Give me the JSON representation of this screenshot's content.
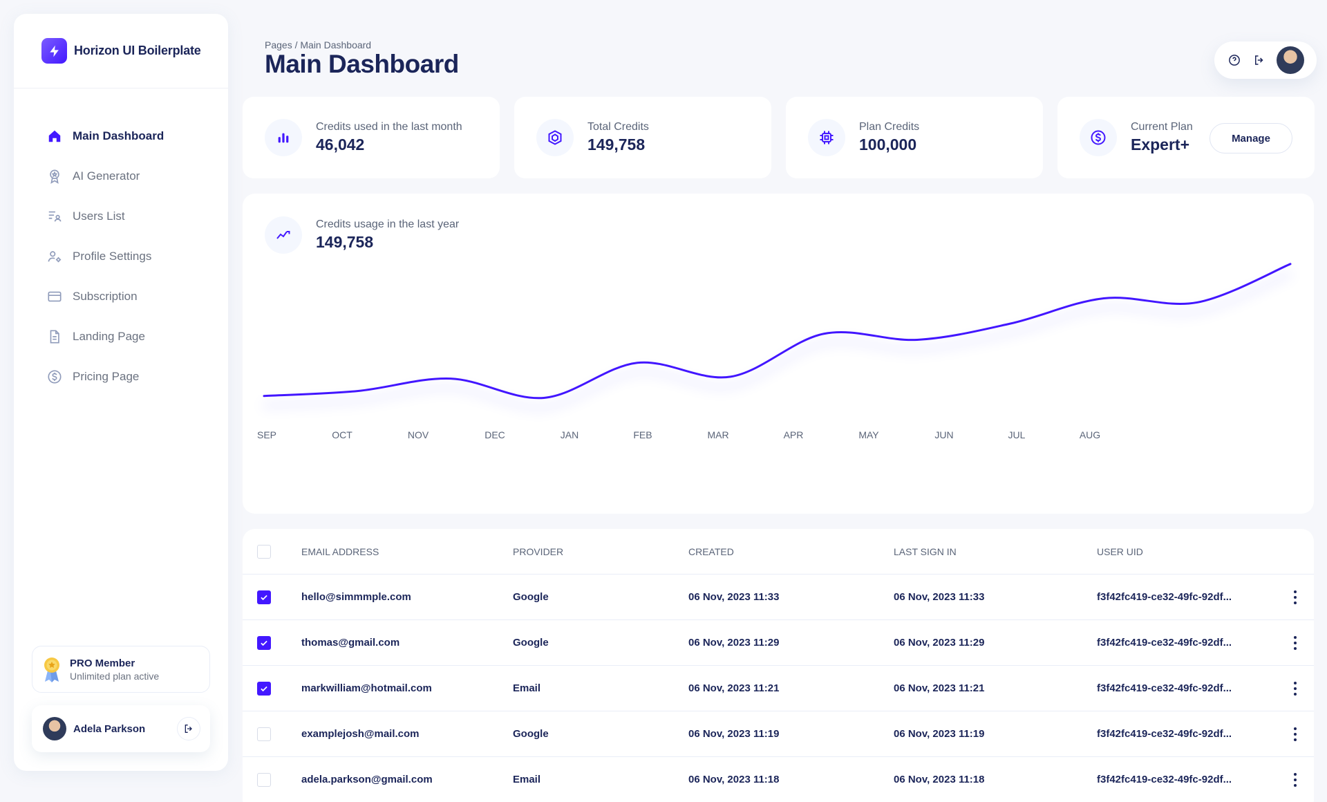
{
  "brand": {
    "name": "Horizon UI Boilerplate",
    "accent": "#4318FF"
  },
  "sidebar": {
    "items": [
      {
        "label": "Main Dashboard",
        "icon": "home-icon",
        "active": true
      },
      {
        "label": "AI Generator",
        "icon": "award-icon",
        "active": false
      },
      {
        "label": "Users List",
        "icon": "users-list-icon",
        "active": false
      },
      {
        "label": "Profile Settings",
        "icon": "user-settings-icon",
        "active": false
      },
      {
        "label": "Subscription",
        "icon": "credit-card-icon",
        "active": false
      },
      {
        "label": "Landing Page",
        "icon": "document-icon",
        "active": false
      },
      {
        "label": "Pricing Page",
        "icon": "dollar-circle-icon",
        "active": false
      }
    ],
    "pro": {
      "title": "PRO Member",
      "subtitle": "Unlimited plan active"
    },
    "user": {
      "name": "Adela Parkson"
    }
  },
  "header": {
    "breadcrumb": "Pages / Main Dashboard",
    "title": "Main Dashboard"
  },
  "stats": [
    {
      "label": "Credits used in the last month",
      "value": "46,042",
      "icon": "bar-chart-icon"
    },
    {
      "label": "Total Credits",
      "value": "149,758",
      "icon": "cube-icon"
    },
    {
      "label": "Plan Credits",
      "value": "100,000",
      "icon": "chip-icon"
    },
    {
      "label": "Current Plan",
      "value": "Expert+",
      "icon": "dollar-circle-icon",
      "action": "Manage"
    }
  ],
  "chart_data": {
    "type": "line",
    "label": "Credits usage in the last year",
    "value": "149,758",
    "categories": [
      "SEP",
      "OCT",
      "NOV",
      "DEC",
      "JAN",
      "FEB",
      "MAR",
      "APR",
      "MAY",
      "JUN",
      "JUL",
      "AUG"
    ],
    "values": [
      50,
      63,
      96,
      45,
      138,
      101,
      215,
      199,
      242,
      309,
      298,
      400
    ],
    "ylim": [
      0,
      440
    ],
    "line_color": "#4318FF"
  },
  "table": {
    "columns": [
      "EMAIL ADDRESS",
      "PROVIDER",
      "CREATED",
      "LAST SIGN IN",
      "USER UID"
    ],
    "rows": [
      {
        "checked": true,
        "email": "hello@simmmple.com",
        "provider": "Google",
        "created": "06 Nov, 2023 11:33",
        "last": "06 Nov, 2023 11:33",
        "uid": "f3f42fc419-ce32-49fc-92df..."
      },
      {
        "checked": true,
        "email": "thomas@gmail.com",
        "provider": "Google",
        "created": "06 Nov, 2023 11:29",
        "last": "06 Nov, 2023 11:29",
        "uid": "f3f42fc419-ce32-49fc-92df..."
      },
      {
        "checked": true,
        "email": "markwilliam@hotmail.com",
        "provider": "Email",
        "created": "06 Nov, 2023 11:21",
        "last": "06 Nov, 2023 11:21",
        "uid": "f3f42fc419-ce32-49fc-92df..."
      },
      {
        "checked": false,
        "email": "examplejosh@mail.com",
        "provider": "Google",
        "created": "06 Nov, 2023 11:19",
        "last": "06 Nov, 2023 11:19",
        "uid": "f3f42fc419-ce32-49fc-92df..."
      },
      {
        "checked": false,
        "email": "adela.parkson@gmail.com",
        "provider": "Email",
        "created": "06 Nov, 2023 11:18",
        "last": "06 Nov, 2023 11:18",
        "uid": "f3f42fc419-ce32-49fc-92df..."
      }
    ]
  }
}
